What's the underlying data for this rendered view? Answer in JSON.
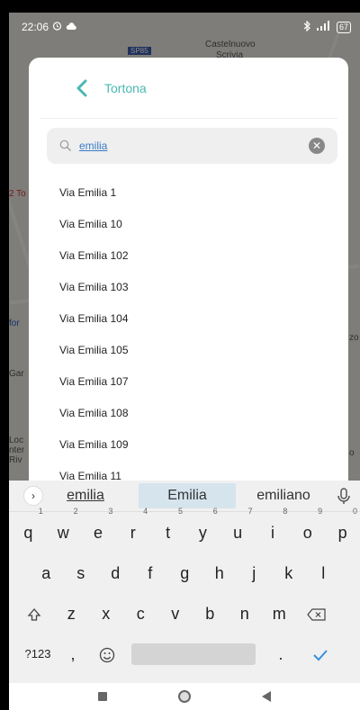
{
  "status_bar": {
    "time": "22:06",
    "icons": [
      "alarm-icon",
      "cloud-icon",
      "bluetooth-icon",
      "signal-icon"
    ],
    "battery": "67"
  },
  "map_labels": {
    "top_badge": "SP85",
    "castelnuovo": "Castelnuovo",
    "scrivia": "Scrivia",
    "left_1": "2 To",
    "left_2": "for",
    "left_3": "Gar",
    "left_4": "Loc",
    "left_5": "nter",
    "left_6": "Riv",
    "right_1": "zo",
    "right_2": "o"
  },
  "sheet": {
    "city": "Tortona",
    "search_value": "emilia",
    "results": [
      "Via Emilia 1",
      "Via Emilia 10",
      "Via Emilia 102",
      "Via Emilia 103",
      "Via Emilia 104",
      "Via Emilia 105",
      "Via Emilia 107",
      "Via Emilia 108",
      "Via Emilia 109",
      "Via Emilia 11"
    ]
  },
  "keyboard": {
    "suggestions": [
      "emilia",
      "Emilia",
      "emiliano"
    ],
    "row1": [
      {
        "key": "q",
        "num": "1"
      },
      {
        "key": "w",
        "num": "2"
      },
      {
        "key": "e",
        "num": "3"
      },
      {
        "key": "r",
        "num": "4"
      },
      {
        "key": "t",
        "num": "5"
      },
      {
        "key": "y",
        "num": "6"
      },
      {
        "key": "u",
        "num": "7"
      },
      {
        "key": "i",
        "num": "8"
      },
      {
        "key": "o",
        "num": "9"
      },
      {
        "key": "p",
        "num": "0"
      }
    ],
    "row2": [
      "a",
      "s",
      "d",
      "f",
      "g",
      "h",
      "j",
      "k",
      "l"
    ],
    "row3": [
      "z",
      "x",
      "c",
      "v",
      "b",
      "n",
      "m"
    ],
    "row4": {
      "symbols": "?123",
      "comma": ",",
      "period": "."
    }
  },
  "colors": {
    "accent": "#4ab8b0",
    "suggestion_highlight": "#d6e4ee",
    "enter_check": "#3a8fd8"
  }
}
